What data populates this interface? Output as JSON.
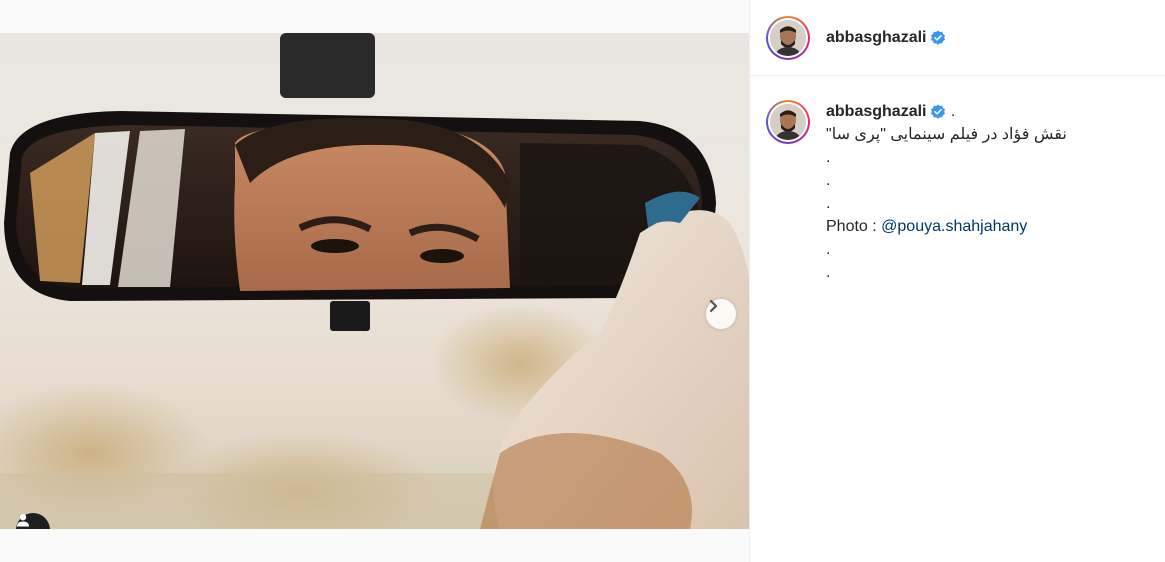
{
  "post": {
    "username": "abbasghazali",
    "verified": true,
    "caption": {
      "username": "abbasghazali",
      "after_name": " .",
      "lines": [
        "\"نقش فؤاد در فیلم سینمایی \"پری سا",
        ".",
        ".",
        "."
      ],
      "photo_prefix": "Photo : ",
      "photo_mention": "@pouya.shahjahany",
      "trailing_lines": [
        ".",
        "."
      ]
    },
    "carousel": {
      "total": 2,
      "current": 1
    }
  },
  "icons": {
    "next": "chevron-right-icon",
    "tagged_users": "user-icon",
    "verified": "verified-badge-icon"
  },
  "colors": {
    "verified_blue": "#3897f0",
    "mention": "#00376b",
    "text": "#262626"
  }
}
